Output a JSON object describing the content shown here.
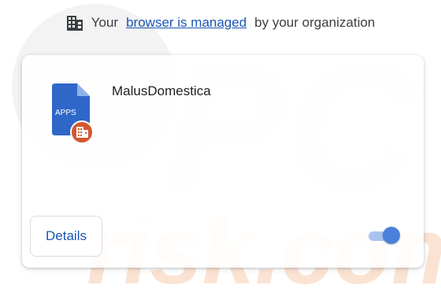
{
  "banner": {
    "prefix": "Your",
    "link": "browser is managed",
    "suffix": "by your organization",
    "icon": "building-icon"
  },
  "extension": {
    "name": "MalusDomestica",
    "icon_label": "APPS",
    "badge_icon": "building-icon",
    "details_label": "Details",
    "enabled": true
  },
  "colors": {
    "link": "#1a56b5",
    "app_icon_blue": "#2f67c9",
    "badge_orange": "#d2572f",
    "toggle_on": "#4a7fdc"
  }
}
